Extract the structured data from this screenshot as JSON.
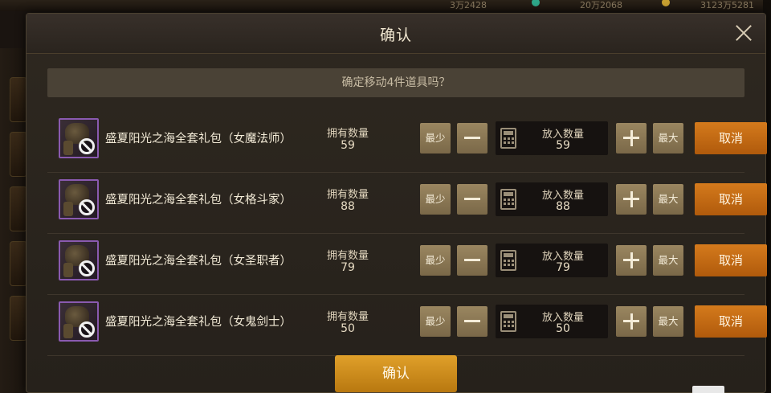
{
  "background": {
    "topbar": {
      "stat1": "3万2428",
      "stat2": "20万2068",
      "stat3": "3123万5281"
    }
  },
  "dialog": {
    "title": "确认",
    "prompt": "确定移动4件道具吗？",
    "confirm_label": "确认"
  },
  "rows": [
    {
      "name": "盛夏阳光之海全套礼包（女魔法师）",
      "own_label": "拥有数量",
      "own_value": "59",
      "min_label": "最少",
      "qty_label": "放入数量",
      "qty_value": "59",
      "max_label": "最大",
      "cancel_label": "取消"
    },
    {
      "name": "盛夏阳光之海全套礼包（女格斗家）",
      "own_label": "拥有数量",
      "own_value": "88",
      "min_label": "最少",
      "qty_label": "放入数量",
      "qty_value": "88",
      "max_label": "最大",
      "cancel_label": "取消"
    },
    {
      "name": "盛夏阳光之海全套礼包（女圣职者）",
      "own_label": "拥有数量",
      "own_value": "79",
      "min_label": "最少",
      "qty_label": "放入数量",
      "qty_value": "79",
      "max_label": "最大",
      "cancel_label": "取消"
    },
    {
      "name": "盛夏阳光之海全套礼包（女鬼剑士）",
      "own_label": "拥有数量",
      "own_value": "50",
      "min_label": "最少",
      "qty_label": "放入数量",
      "qty_value": "50",
      "max_label": "最大",
      "cancel_label": "取消"
    }
  ],
  "icons": {
    "close": "close-icon",
    "minus": "minus-icon",
    "plus": "plus-icon",
    "calculator": "calculator-icon",
    "ban": "ban-icon"
  },
  "colors": {
    "cancel_accent": "#d47a1c",
    "confirm_accent": "#e0a02a",
    "item_border": "#8a5ab0"
  }
}
